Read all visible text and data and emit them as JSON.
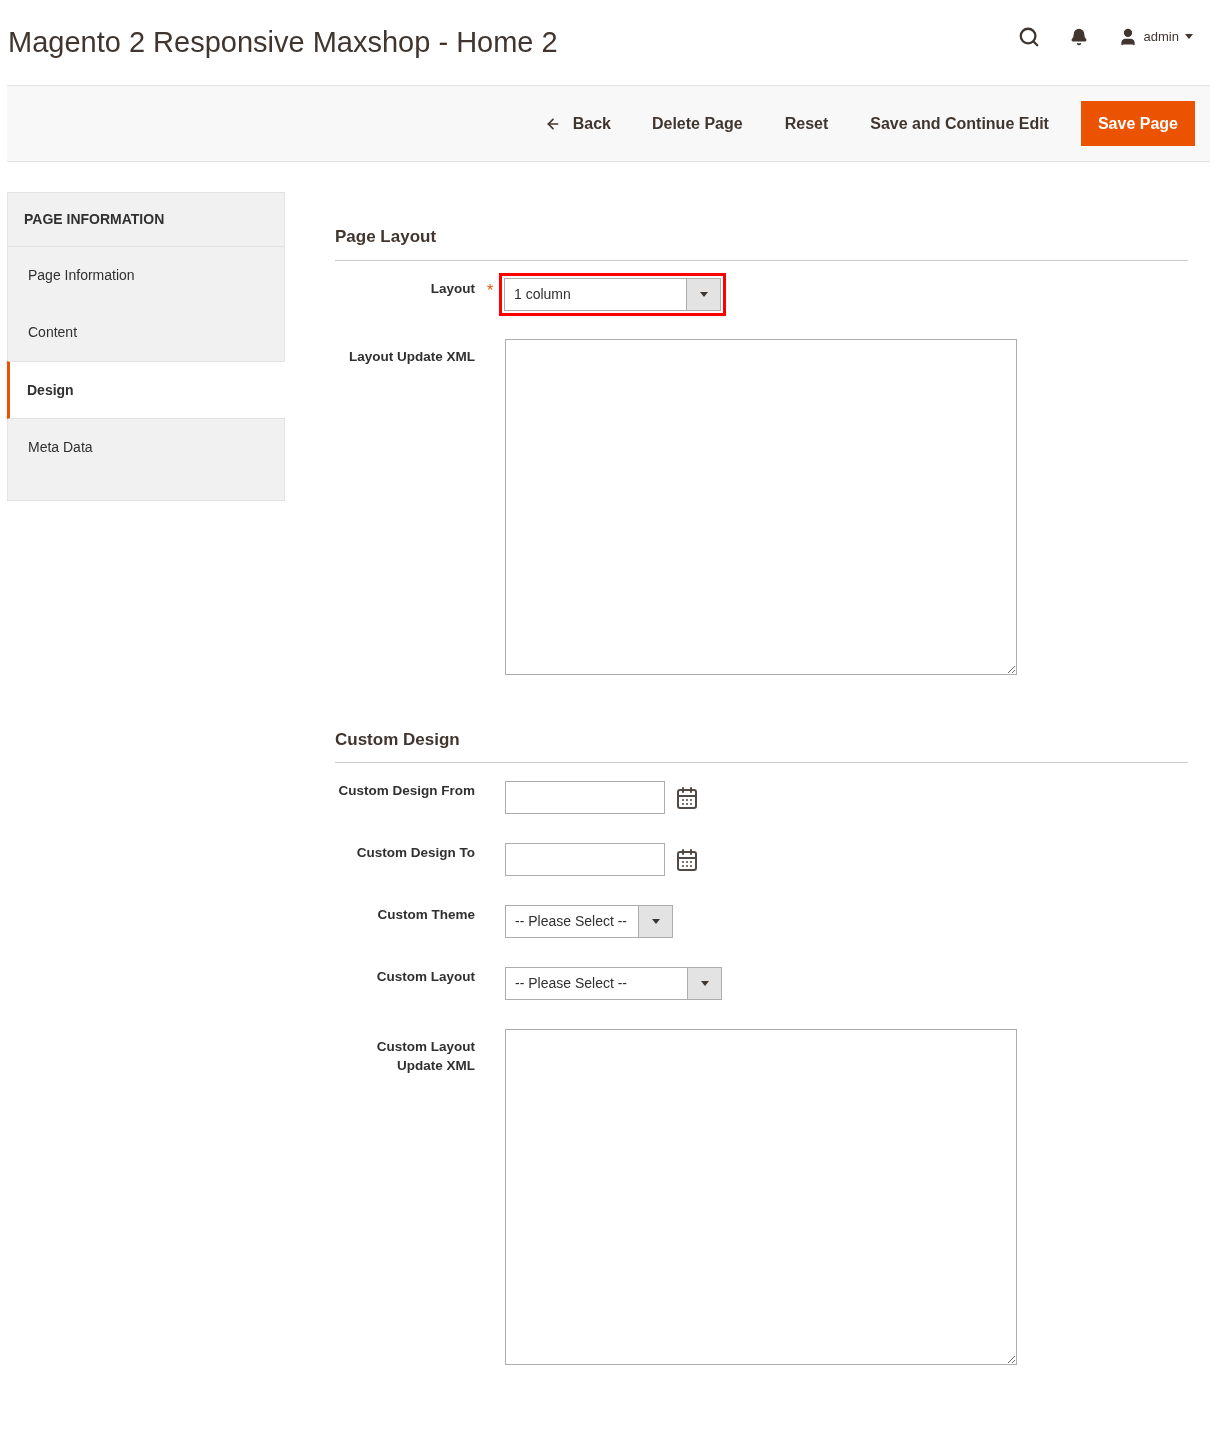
{
  "header": {
    "title": "Magento 2 Responsive Maxshop - Home 2",
    "user": "admin"
  },
  "toolbar": {
    "buttons": [
      {
        "label": "Back",
        "kind": "back"
      },
      {
        "label": "Delete Page",
        "kind": "plain"
      },
      {
        "label": "Reset",
        "kind": "plain"
      },
      {
        "label": "Save and Continue Edit",
        "kind": "plain"
      },
      {
        "label": "Save Page",
        "kind": "primary"
      }
    ]
  },
  "sidebar": {
    "heading": "PAGE INFORMATION",
    "items": [
      {
        "label": "Page Information",
        "selected": false
      },
      {
        "label": "Content",
        "selected": false
      },
      {
        "label": "Design",
        "selected": true
      },
      {
        "label": "Meta Data",
        "selected": false
      }
    ]
  },
  "sections": [
    {
      "title": "Page Layout",
      "fields": [
        {
          "kind": "select",
          "label": "Layout",
          "required_mark": "*",
          "highlighted": true,
          "value": "1 column"
        },
        {
          "kind": "textarea",
          "label": "Layout Update XML"
        }
      ]
    },
    {
      "title": "Custom Design",
      "fields": [
        {
          "kind": "date",
          "label": "Custom Design From"
        },
        {
          "kind": "date",
          "label": "Custom Design To"
        },
        {
          "kind": "compact-select",
          "label": "Custom Theme",
          "value": "-- Please Select --"
        },
        {
          "kind": "select",
          "label": "Custom Layout",
          "value": "-- Please Select --"
        },
        {
          "kind": "textarea",
          "label": "Custom Layout Update XML"
        }
      ]
    }
  ]
}
